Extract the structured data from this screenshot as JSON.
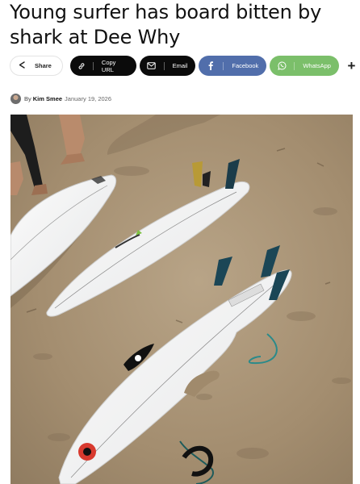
{
  "article": {
    "headline": "Young surfer has board bitten by shark at Dee Why"
  },
  "share_bar": {
    "share_label": "Share",
    "copy_url_label": "Copy URL",
    "email_label": "Email",
    "facebook_label": "Facebook",
    "whatsapp_label": "WhatsApp",
    "more_label": "+"
  },
  "byline": {
    "by_label": "By",
    "author": "Kim Smee",
    "date": "January 19, 2026"
  },
  "colors": {
    "facebook": "#516eab",
    "whatsapp": "#7bbf6a",
    "dark_button": "#0b0b0b",
    "sand": "#a89478"
  },
  "icons": [
    "share-icon",
    "link-icon",
    "email-icon",
    "facebook-icon",
    "whatsapp-icon",
    "plus-icon"
  ]
}
